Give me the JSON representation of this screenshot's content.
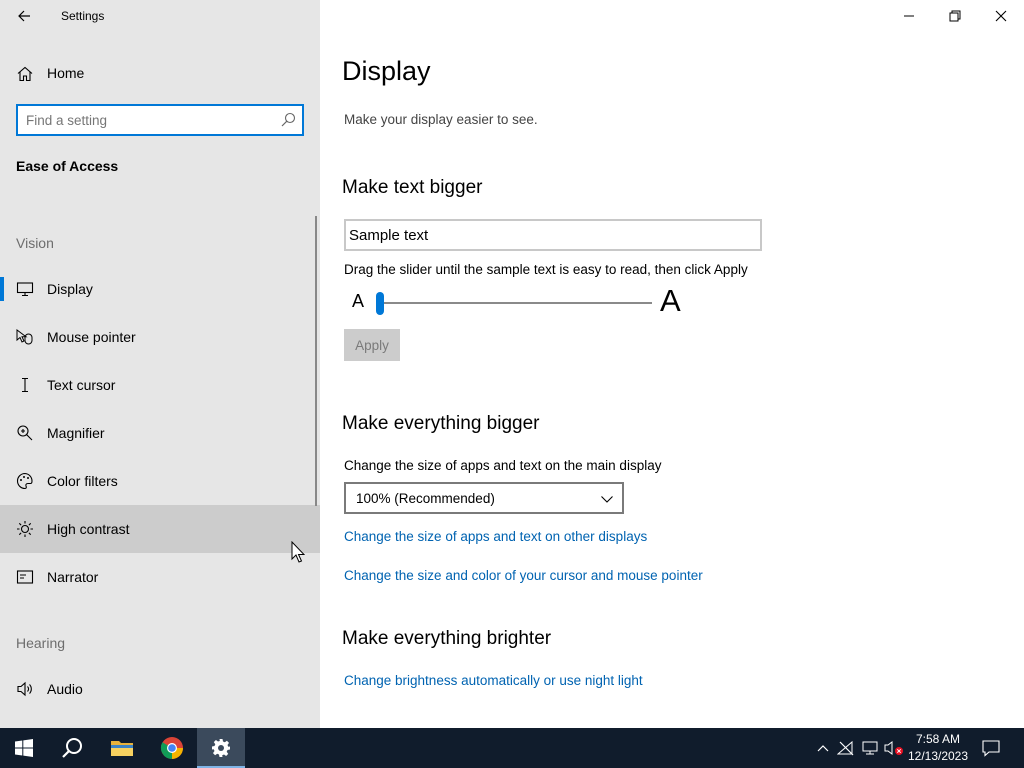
{
  "window": {
    "title": "Settings"
  },
  "sidebar": {
    "home_label": "Home",
    "search_placeholder": "Find a setting",
    "section_title": "Ease of Access",
    "groups": {
      "vision": "Vision",
      "hearing": "Hearing"
    },
    "items": [
      {
        "label": "Display",
        "icon": "monitor-icon",
        "selected": true
      },
      {
        "label": "Mouse pointer",
        "icon": "mouse-pointer-icon"
      },
      {
        "label": "Text cursor",
        "icon": "text-cursor-icon"
      },
      {
        "label": "Magnifier",
        "icon": "magnifier-icon"
      },
      {
        "label": "Color filters",
        "icon": "color-filters-icon"
      },
      {
        "label": "High contrast",
        "icon": "high-contrast-icon",
        "hovered": true
      },
      {
        "label": "Narrator",
        "icon": "narrator-icon"
      },
      {
        "label": "Audio",
        "icon": "audio-icon"
      }
    ]
  },
  "main": {
    "title": "Display",
    "description": "Make your display easier to see.",
    "text_bigger": {
      "heading": "Make text bigger",
      "sample_text": "Sample text",
      "hint": "Drag the slider until the sample text is easy to read, then click Apply",
      "small_a": "A",
      "big_a": "A",
      "slider_value_fraction": 0.0,
      "apply_label": "Apply"
    },
    "everything_bigger": {
      "heading": "Make everything bigger",
      "label": "Change the size of apps and text on the main display",
      "dropdown_value": "100% (Recommended)",
      "link_other_displays": "Change the size of apps and text on other displays",
      "link_cursor": "Change the size and color of your cursor and mouse pointer"
    },
    "everything_brighter": {
      "heading": "Make everything brighter",
      "link_brightness": "Change brightness automatically or use night light"
    }
  },
  "taskbar": {
    "time": "7:58 AM",
    "date": "12/13/2023"
  },
  "colors": {
    "accent": "#0078d7",
    "link": "#0063b1",
    "sidebar_bg": "#e6e6e6",
    "taskbar_bg": "#101c2c"
  }
}
